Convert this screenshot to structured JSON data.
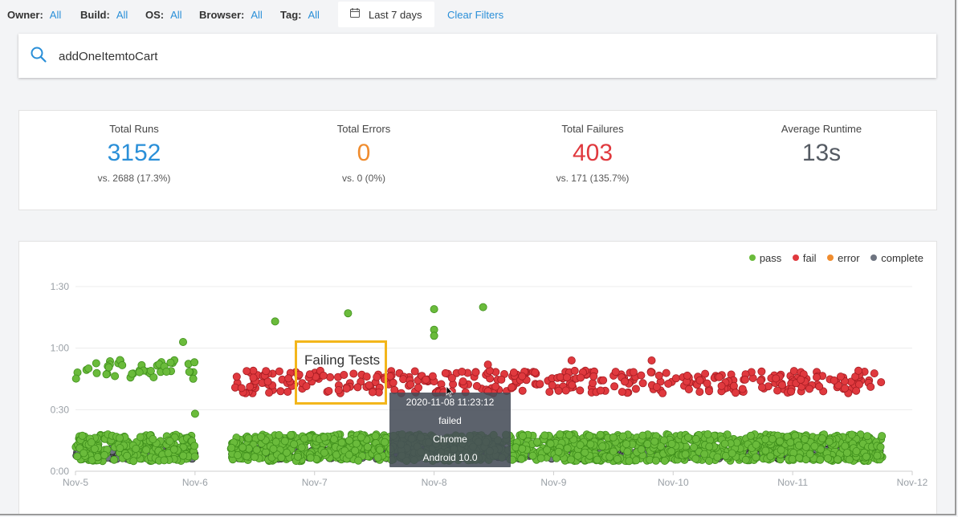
{
  "filters": [
    {
      "label": "Owner:",
      "value": "All"
    },
    {
      "label": "Build:",
      "value": "All"
    },
    {
      "label": "OS:",
      "value": "All"
    },
    {
      "label": "Browser:",
      "value": "All"
    },
    {
      "label": "Tag:",
      "value": "All"
    }
  ],
  "date_range": {
    "label": "Last 7 days",
    "icon": "calendar-icon"
  },
  "clear_filters": "Clear Filters",
  "search": {
    "value": "addOneItemtoCart",
    "icon": "search-icon"
  },
  "stats": [
    {
      "title": "Total Runs",
      "value": "3152",
      "compare": "vs. 2688 (17.3%)",
      "color": "#2a8fd8"
    },
    {
      "title": "Total Errors",
      "value": "0",
      "compare": "vs. 0 (0%)",
      "color": "#f08c2e"
    },
    {
      "title": "Total Failures",
      "value": "403",
      "compare": "vs. 171 (135.7%)",
      "color": "#e0393e"
    },
    {
      "title": "Average Runtime",
      "value": "13s",
      "compare": "",
      "color": "#555b63"
    }
  ],
  "legend": [
    {
      "label": "pass",
      "color": "#6abb3b"
    },
    {
      "label": "fail",
      "color": "#e0393e"
    },
    {
      "label": "error",
      "color": "#f08c2e"
    },
    {
      "label": "complete",
      "color": "#6e7480"
    }
  ],
  "annotation": "Failing Tests",
  "tooltip": {
    "time": "2020-11-08 11:23:12",
    "status": "failed",
    "browser": "Chrome",
    "os": "Android 10.0"
  },
  "chart_data": {
    "type": "scatter",
    "y_unit": "runtime (m:ss)",
    "y_ticks": [
      "0:00",
      "0:30",
      "1:00",
      "1:30"
    ],
    "y_tick_seconds": [
      0,
      30,
      60,
      90
    ],
    "ylim": [
      0,
      90
    ],
    "x_ticks": [
      "Nov-5",
      "Nov-6",
      "Nov-7",
      "Nov-8",
      "Nov-9",
      "Nov-10",
      "Nov-11",
      "Nov-12"
    ],
    "xlim": [
      0,
      7
    ],
    "grid": true,
    "legend_position": "top-right",
    "series": [
      {
        "name": "pass",
        "color": "#6abb3b",
        "clusters": [
          {
            "x_range": [
              0.0,
              1.0
            ],
            "y_range": [
              5,
              18
            ],
            "count": 240
          },
          {
            "x_range": [
              0.0,
              1.0
            ],
            "y_range": [
              45,
              55
            ],
            "count": 45
          },
          {
            "x_range": [
              1.3,
              6.75
            ],
            "y_range": [
              5,
              18
            ],
            "count": 1400
          }
        ],
        "outliers": [
          [
            1.67,
            73
          ],
          [
            2.28,
            77
          ],
          [
            3.0,
            79
          ],
          [
            3.0,
            69
          ],
          [
            3.0,
            66
          ],
          [
            3.41,
            80
          ],
          [
            0.9,
            63
          ],
          [
            1.0,
            28
          ]
        ]
      },
      {
        "name": "fail",
        "color": "#e0393e",
        "clusters": [
          {
            "x_range": [
              1.3,
              6.75
            ],
            "y_range": [
              38,
              49
            ],
            "count": 380
          }
        ],
        "outliers": [
          [
            3.45,
            52
          ],
          [
            4.15,
            54
          ],
          [
            4.82,
            54
          ],
          [
            6.55,
            49
          ]
        ]
      },
      {
        "name": "complete",
        "color": "#6e7480",
        "clusters": [
          {
            "x_range": [
              0.0,
              1.0
            ],
            "y_range": [
              6,
              11
            ],
            "count": 120
          },
          {
            "x_range": [
              1.3,
              6.75
            ],
            "y_range": [
              6,
              11
            ],
            "count": 350
          }
        ]
      }
    ]
  }
}
